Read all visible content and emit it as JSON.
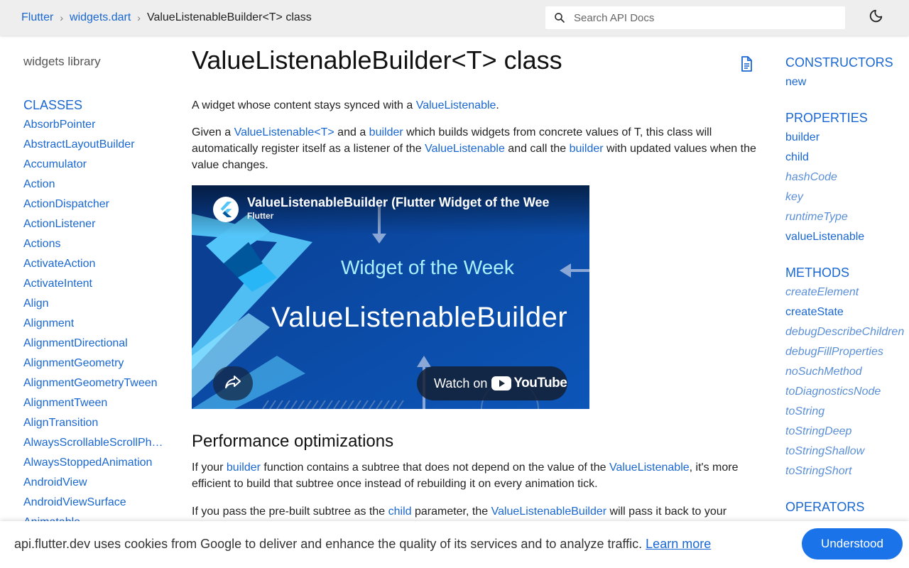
{
  "breadcrumb": {
    "root": "Flutter",
    "file": "widgets.dart",
    "current": "ValueListenableBuilder<T> class"
  },
  "search": {
    "placeholder": "Search API Docs"
  },
  "icons": {
    "search": "search-icon",
    "theme": "moon-icon",
    "doc": "document-icon",
    "share": "share-icon",
    "flutter_logo": "flutter-logo-icon"
  },
  "left": {
    "library_title": "widgets library",
    "classes_header": "CLASSES",
    "classes": [
      "AbsorbPointer",
      "AbstractLayoutBuilder",
      "Accumulator",
      "Action",
      "ActionDispatcher",
      "ActionListener",
      "Actions",
      "ActivateAction",
      "ActivateIntent",
      "Align",
      "Alignment",
      "AlignmentDirectional",
      "AlignmentGeometry",
      "AlignmentGeometryTween",
      "AlignmentTween",
      "AlignTransition",
      "AlwaysScrollableScrollPhysics",
      "AlwaysStoppedAnimation",
      "AndroidView",
      "AndroidViewSurface",
      "Animatable"
    ]
  },
  "main": {
    "title": "ValueListenableBuilder<T> class",
    "p1": {
      "a": "A widget whose content stays synced with a ",
      "link": "ValueListenable",
      "b": "."
    },
    "p2": {
      "a": "Given a ",
      "link1": "ValueListenable<T>",
      "b": " and a ",
      "link2": "builder",
      "c": " which builds widgets from concrete values of T, this class will automatically register itself as a listener of the ",
      "link3": "ValueListenable",
      "d": " and call the ",
      "link4": "builder",
      "e": " with updated values when the value changes."
    },
    "video": {
      "title": "ValueListenableBuilder (Flutter Widget of the Wee",
      "channel": "Flutter",
      "subtitle": "Widget of the Week",
      "big_title": "ValueListenableBuilder",
      "watch_label": "Watch on",
      "youtube_label": "YouTube"
    },
    "h2": "Performance optimizations",
    "p3": {
      "a": "If your ",
      "link1": "builder",
      "b": " function contains a subtree that does not depend on the value of the ",
      "link2": "ValueListenable",
      "c": ", it's more efficient to build that subtree once instead of rebuilding it on every animation tick."
    },
    "p4": {
      "a": "If you pass the pre-built subtree as the ",
      "link1": "child",
      "b": " parameter, the ",
      "link2": "ValueListenableBuilder",
      "c": " will pass it back to your"
    }
  },
  "right": {
    "constructors_header": "CONSTRUCTORS",
    "constructors": [
      {
        "label": "new",
        "inherited": false
      }
    ],
    "properties_header": "PROPERTIES",
    "properties": [
      {
        "label": "builder",
        "inherited": false
      },
      {
        "label": "child",
        "inherited": false
      },
      {
        "label": "hashCode",
        "inherited": true
      },
      {
        "label": "key",
        "inherited": true
      },
      {
        "label": "runtimeType",
        "inherited": true
      },
      {
        "label": "valueListenable",
        "inherited": false
      }
    ],
    "methods_header": "METHODS",
    "methods": [
      {
        "label": "createElement",
        "inherited": true
      },
      {
        "label": "createState",
        "inherited": false
      },
      {
        "label": "debugDescribeChildren",
        "inherited": true
      },
      {
        "label": "debugFillProperties",
        "inherited": true
      },
      {
        "label": "noSuchMethod",
        "inherited": true
      },
      {
        "label": "toDiagnosticsNode",
        "inherited": true
      },
      {
        "label": "toString",
        "inherited": true
      },
      {
        "label": "toStringDeep",
        "inherited": true
      },
      {
        "label": "toStringShallow",
        "inherited": true
      },
      {
        "label": "toStringShort",
        "inherited": true
      }
    ],
    "operators_header": "OPERATORS"
  },
  "cookie": {
    "text": "api.flutter.dev uses cookies from Google to deliver and enhance the quality of its services and to analyze traffic. ",
    "learn_more": "Learn more",
    "button": "Understood"
  },
  "colors": {
    "link": "#1967d2",
    "header_bg": "#eeeeee",
    "button": "#1a73e8",
    "video_bg": "#0d4aa3"
  }
}
